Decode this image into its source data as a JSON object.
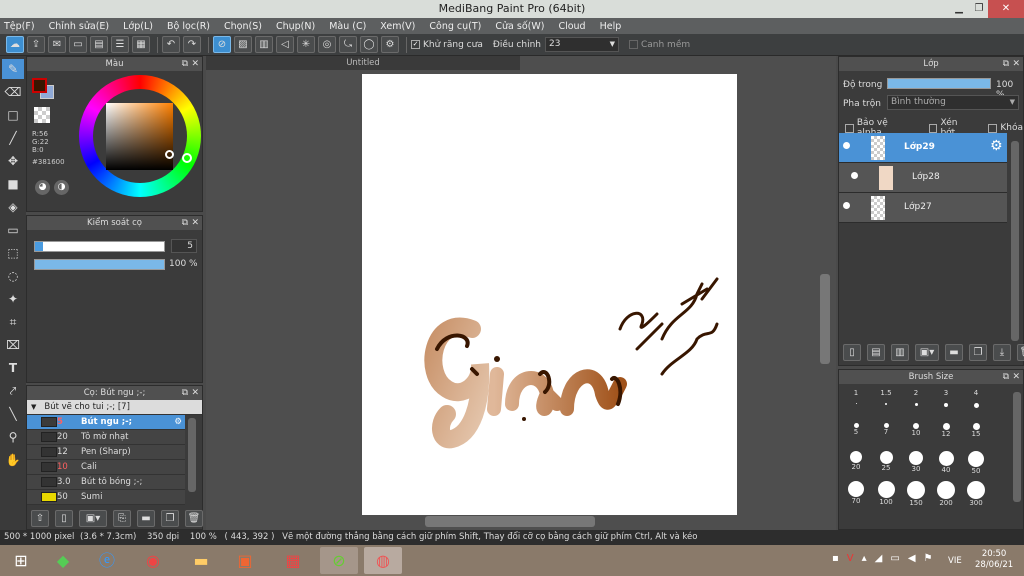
{
  "app_title": "MediBang Paint Pro (64bit)",
  "menu": [
    "Tệp(F)",
    "Chỉnh sửa(E)",
    "Lớp(L)",
    "Bộ lọc(R)",
    "Chọn(S)",
    "Chụp(N)",
    "Màu (C)",
    "Xem(V)",
    "Công cụ(T)",
    "Cửa số(W)",
    "Cloud",
    "Help"
  ],
  "toolbar": {
    "antialias_label": "Khử răng cưa",
    "correction_label": "Điều chỉnh",
    "correction_value": "23",
    "snap_label": "Canh mềm"
  },
  "color_panel": {
    "title": "Màu",
    "r": "R:56",
    "g": "G:22",
    "b": "B:0",
    "hex": "#381600",
    "fg_color": "#381600",
    "bg_color": "#8fa9d6"
  },
  "brush_control": {
    "title": "Kiểm soát cọ",
    "size_value": "5",
    "opacity_value": "100 %"
  },
  "brush_panel": {
    "title": "Cọ: Bút ngu ;-;",
    "group": "Bút vẽ cho tui ;-; [7]",
    "items": [
      {
        "size": "5",
        "name": "Bút ngu ;-;",
        "size_color": "#ff6060"
      },
      {
        "size": "20",
        "name": "Tô mờ nhạt",
        "size_color": "#dddddd"
      },
      {
        "size": "12",
        "name": "Pen (Sharp)",
        "size_color": "#dddddd"
      },
      {
        "size": "10",
        "name": "Cali",
        "size_color": "#ff6060"
      },
      {
        "size": "3.0",
        "name": "Bút tô bóng ;-;",
        "size_color": "#dddddd"
      },
      {
        "size": "50",
        "name": "Sumi",
        "size_color": "#dddddd"
      }
    ]
  },
  "canvas": {
    "tab": "Untitled"
  },
  "layer_panel": {
    "title": "Lớp",
    "opacity_label": "Độ trong",
    "opacity_value": "100 %",
    "blend_label": "Pha trộn",
    "blend_value": "Bình thường",
    "protect_alpha": "Bảo vệ alpha",
    "clipping": "Xén bớt",
    "lock": "Khóa",
    "layers": [
      "Lớp29",
      "Lớp28",
      "Lớp27"
    ]
  },
  "brush_size_panel": {
    "title": "Brush Size",
    "sizes": [
      "1",
      "1.5",
      "2",
      "3",
      "4",
      "5",
      "7",
      "10",
      "12",
      "15",
      "20",
      "25",
      "30",
      "40",
      "50",
      "70",
      "100",
      "150",
      "200",
      "300"
    ]
  },
  "status": {
    "dimensions": "500 * 1000 pixel",
    "cm": "(3.6 * 7.3cm)",
    "dpi": "350 dpi",
    "zoom": "100 %",
    "coords": "( 443, 392 )",
    "hint": "Vẽ một đường thẳng bằng cách giữ phím Shift, Thay đổi cỡ cọ bằng cách giữ phím Ctrl, Alt và kéo"
  },
  "taskbar": {
    "lang": "VIE",
    "time": "20:50",
    "date": "28/06/21"
  }
}
